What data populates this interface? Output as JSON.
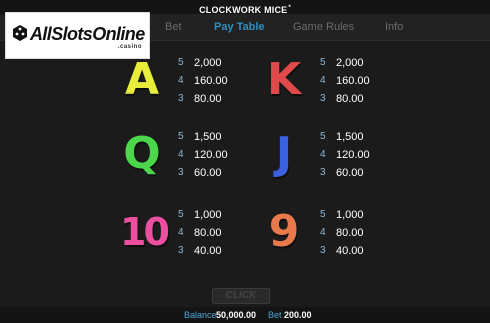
{
  "header": {
    "title": "CLOCKWORK MICE",
    "title_mark": "*"
  },
  "tabs": [
    {
      "label": "Bet",
      "active": false
    },
    {
      "label": "Pay Table",
      "active": true
    },
    {
      "label": "Game Rules",
      "active": false
    },
    {
      "label": "Info",
      "active": false
    }
  ],
  "logo": {
    "main": "AllSlotsOnline",
    "sub": ".casino",
    "icon": "dice-icon"
  },
  "paytable": [
    {
      "symbol": "A",
      "color": "#e8ec3a",
      "rows": [
        {
          "count": "5",
          "value": "2,000"
        },
        {
          "count": "4",
          "value": "160.00"
        },
        {
          "count": "3",
          "value": "80.00"
        }
      ]
    },
    {
      "symbol": "K",
      "color": "#e04a4a",
      "rows": [
        {
          "count": "5",
          "value": "2,000"
        },
        {
          "count": "4",
          "value": "160.00"
        },
        {
          "count": "3",
          "value": "80.00"
        }
      ]
    },
    {
      "symbol": "Q",
      "color": "#4cd64c",
      "rows": [
        {
          "count": "5",
          "value": "1,500"
        },
        {
          "count": "4",
          "value": "120.00"
        },
        {
          "count": "3",
          "value": "60.00"
        }
      ]
    },
    {
      "symbol": "J",
      "color": "#3a62e0",
      "rows": [
        {
          "count": "5",
          "value": "1,500"
        },
        {
          "count": "4",
          "value": "120.00"
        },
        {
          "count": "3",
          "value": "60.00"
        }
      ]
    },
    {
      "symbol": "10",
      "color": "#ec4fa0",
      "rows": [
        {
          "count": "5",
          "value": "1,000"
        },
        {
          "count": "4",
          "value": "80.00"
        },
        {
          "count": "3",
          "value": "40.00"
        }
      ]
    },
    {
      "symbol": "9",
      "color": "#e8794a",
      "rows": [
        {
          "count": "5",
          "value": "1,000"
        },
        {
          "count": "4",
          "value": "80.00"
        },
        {
          "count": "3",
          "value": "40.00"
        }
      ]
    }
  ],
  "controls": {
    "spin_label": "CLICK"
  },
  "footer": {
    "balance_label": "Balance",
    "balance_value": "50,000.00",
    "bet_label": "Bet",
    "bet_value": "200.00"
  }
}
